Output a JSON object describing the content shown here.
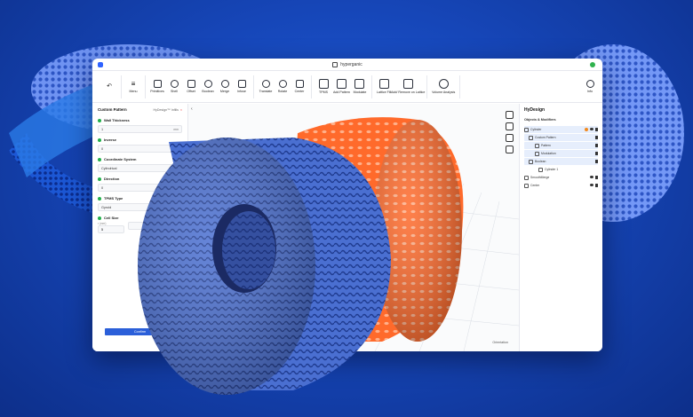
{
  "window": {
    "app_name": "hyperganic"
  },
  "toolbar": {
    "undo_label": "",
    "groups": [
      [
        {
          "label": "Menu",
          "icon": "menu-icon"
        }
      ],
      [
        {
          "label": "Primitives",
          "icon": "cube-icon"
        },
        {
          "label": "Shell",
          "icon": "shell-icon"
        },
        {
          "label": "Offset",
          "icon": "offset-icon"
        },
        {
          "label": "Boolean",
          "icon": "boolean-icon"
        },
        {
          "label": "Merge",
          "icon": "merge-icon"
        },
        {
          "label": "Infuse",
          "icon": "infuse-icon"
        }
      ],
      [
        {
          "label": "Translate",
          "icon": "translate-icon"
        },
        {
          "label": "Rotate",
          "icon": "rotate-icon"
        },
        {
          "label": "Center",
          "icon": "center-icon"
        }
      ],
      [
        {
          "label": "TPMS",
          "icon": "tpms-icon"
        },
        {
          "label": "Add Pattern",
          "icon": "add-pattern-icon"
        },
        {
          "label": "Modulate",
          "icon": "modulate-icon"
        }
      ],
      [
        {
          "label": "Lattice Fill",
          "icon": "lattice-fill-icon"
        },
        {
          "label": "Add/ Remove on Lattice",
          "icon": "lattice-edit-icon"
        }
      ],
      [
        {
          "label": "Volume Analysis",
          "icon": "volume-analysis-icon"
        }
      ]
    ],
    "info_label": "Info"
  },
  "left_panel": {
    "title": "Custom Pattern",
    "subtitle": "HyDesign™ Infills",
    "fields": [
      {
        "label": "Wall Thickness",
        "value": "1",
        "unit": "mm"
      },
      {
        "label": "Inverse",
        "value": "0",
        "unit": "mm"
      },
      {
        "label": "Coordinate System",
        "value": "Cylindrical",
        "unit": "▾"
      },
      {
        "label": "Direction",
        "value": "0",
        "unit": ""
      },
      {
        "label": "TPMS Type",
        "value": "Gyroid",
        "unit": ""
      }
    ],
    "cell_size": {
      "label": "Cell Size",
      "caption_a": "r (mm)",
      "value_a": "5",
      "caption_b": "",
      "value_b": ""
    },
    "apply_label": "Confirm"
  },
  "viewport": {
    "collapse_glyph": "‹",
    "axes_label": "Orientation"
  },
  "right_panel": {
    "title": "HyDesign",
    "subtitle": "Objects & Modifiers",
    "tree": [
      {
        "label": "Cylinder",
        "indent": 0,
        "selected": true,
        "warn": true
      },
      {
        "label": "Custom Pattern",
        "indent": 1,
        "selected": true,
        "warn": false
      },
      {
        "label": "Pattern",
        "indent": 2,
        "selected": true,
        "warn": false
      },
      {
        "label": "Modulation",
        "indent": 2,
        "selected": true,
        "warn": false
      },
      {
        "label": "Boolean",
        "indent": 1,
        "selected": true,
        "warn": false
      },
      {
        "label": "Cylinder 1",
        "indent": 2,
        "selected": false,
        "warn": false
      },
      {
        "label": "SmoothMerge",
        "indent": 0,
        "selected": false,
        "warn": false
      },
      {
        "label": "Center",
        "indent": 0,
        "selected": false,
        "warn": false
      }
    ]
  },
  "colors": {
    "background": "#1646b8",
    "blue_model": "#4a6fd1",
    "orange_model": "#ff6a2b",
    "accent": "#2b5fd9"
  }
}
